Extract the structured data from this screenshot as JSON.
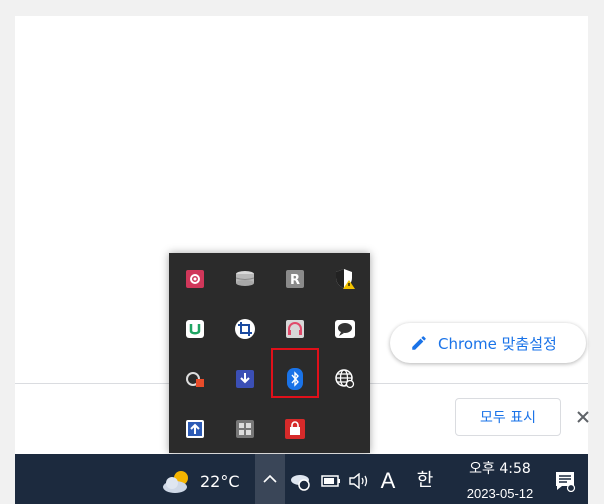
{
  "chrome": {
    "customize_label": "Chrome 맞춤설정",
    "show_all_label": "모두 표시",
    "close_glyph": "✕"
  },
  "tray": {
    "icons": [
      {
        "name": "gear-app-icon",
        "color": "#d0375a"
      },
      {
        "name": "database-icon",
        "color": "#c8c8c8"
      },
      {
        "name": "r-app-icon",
        "color": "#8a8a8a",
        "text": "R"
      },
      {
        "name": "security-shield-warning-icon",
        "color": "#ffffff"
      },
      {
        "name": "green-u-app-icon",
        "color": "#1fa463"
      },
      {
        "name": "crop-tool-icon",
        "color": "#ffffff"
      },
      {
        "name": "headset-icon",
        "color": "#e04a6a"
      },
      {
        "name": "chat-bubble-icon",
        "color": "#ffffff"
      },
      {
        "name": "cloud-sync-icon",
        "color": "#e84c2a"
      },
      {
        "name": "download-app-icon",
        "color": "#3b4fb5"
      },
      {
        "name": "bluetooth-icon",
        "color": "#1a73e8"
      },
      {
        "name": "globe-settings-icon",
        "color": "#ffffff"
      },
      {
        "name": "upload-app-icon",
        "color": "#2d5bb5"
      },
      {
        "name": "grid-app-icon",
        "color": "#c8c8c8"
      },
      {
        "name": "red-lock-app-icon",
        "color": "#d62a2a"
      }
    ]
  },
  "taskbar": {
    "temperature": "22°C",
    "ime_char": "A",
    "hangul_char": "한",
    "time": "오후 4:58",
    "date_partial": "2023-05-12"
  },
  "colors": {
    "taskbar_bg": "#1c2a3e",
    "tray_bg": "#2b2b2b",
    "accent": "#1a73e8",
    "highlight": "#e0101a"
  }
}
